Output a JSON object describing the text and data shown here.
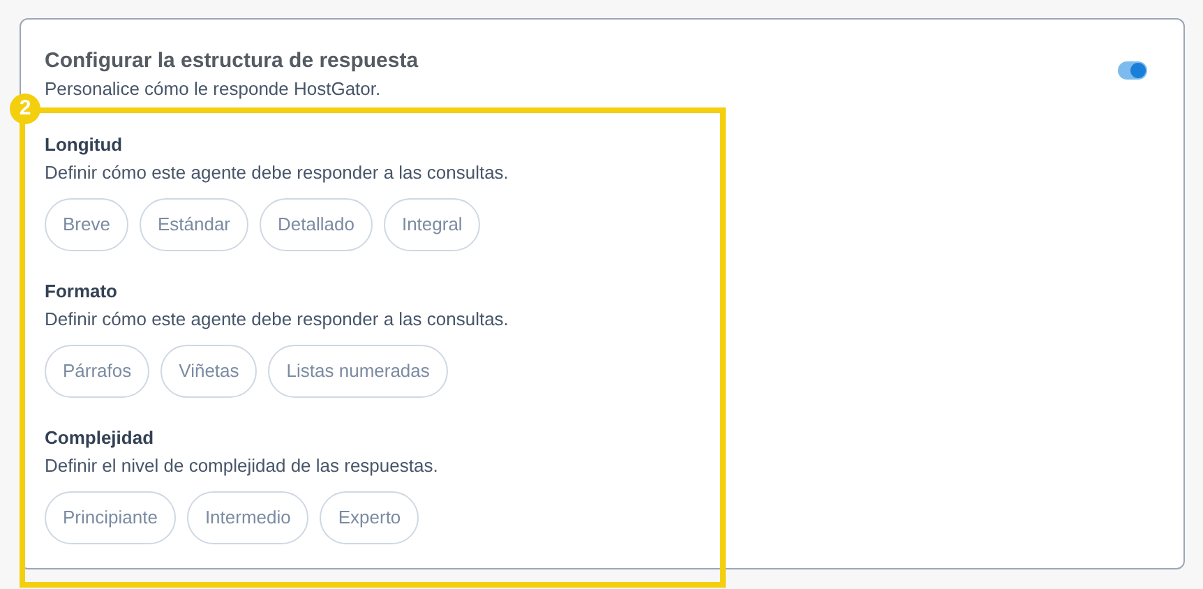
{
  "card": {
    "title": "Configurar la estructura de respuesta",
    "subtitle": "Personalice cómo le responde HostGator.",
    "toggle": {
      "on": true
    }
  },
  "sections": [
    {
      "title": "Longitud",
      "description": "Definir cómo este agente debe responder a las consultas.",
      "options": [
        {
          "label": "Breve",
          "selected": false
        },
        {
          "label": "Estándar",
          "selected": false
        },
        {
          "label": "Detallado",
          "selected": false
        },
        {
          "label": "Integral",
          "selected": false
        }
      ]
    },
    {
      "title": "Formato",
      "description": "Definir cómo este agente debe responder a las consultas.",
      "options": [
        {
          "label": "Párrafos",
          "selected": false
        },
        {
          "label": "Viñetas",
          "selected": false
        },
        {
          "label": "Listas numeradas",
          "selected": false
        }
      ]
    },
    {
      "title": "Complejidad",
      "description": "Definir el nivel de complejidad de las respuestas.",
      "options": [
        {
          "label": "Principiante",
          "selected": false
        },
        {
          "label": "Intermedio",
          "selected": false
        },
        {
          "label": "Experto",
          "selected": false
        }
      ]
    }
  ],
  "annotation": {
    "badge": "2"
  }
}
